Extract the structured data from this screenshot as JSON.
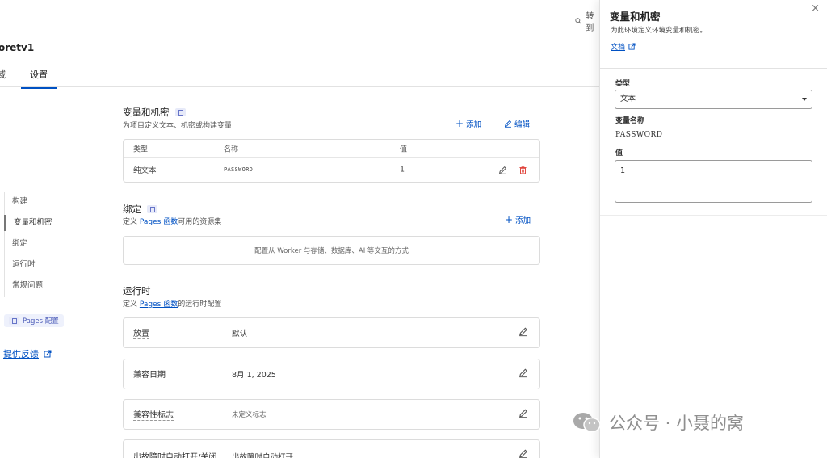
{
  "topbar": {
    "search_label": "转到"
  },
  "project": {
    "title": "oretv1"
  },
  "tabs": [
    "域",
    "设置"
  ],
  "left_nav": {
    "items": [
      "构建",
      "变量和机密",
      "绑定",
      "运行时",
      "常规问题"
    ],
    "pages_badge": "Pages 配置",
    "feedback": "提供反馈"
  },
  "variables": {
    "title": "变量和机密",
    "subtitle": "为项目定义文本、机密或构建变量",
    "add_label": "添加",
    "edit_label": "编辑",
    "columns": [
      "类型",
      "名称",
      "值"
    ],
    "rows": [
      {
        "type": "纯文本",
        "name": "PASSWORD",
        "value": "1"
      }
    ]
  },
  "bindings": {
    "title": "绑定",
    "subtitle_pre": "定义 ",
    "subtitle_link": "Pages 函数",
    "subtitle_post": "可用的资源集",
    "add_label": "添加",
    "empty_text": "配置从 Worker 与存储、数据库、AI 等交互的方式"
  },
  "runtime": {
    "title": "运行时",
    "subtitle_pre": "定义 ",
    "subtitle_link": "Pages 函数",
    "subtitle_post": "的运行时配置",
    "rows": [
      {
        "label": "放置",
        "value": "默认"
      },
      {
        "label": "兼容日期",
        "value": "8月 1, 2025"
      },
      {
        "label": "兼容性标志",
        "value": "未定义标志"
      },
      {
        "label": "出故障时自动打开/关闭",
        "value": "出故障时自动打开"
      }
    ]
  },
  "panel": {
    "title": "变量和机密",
    "subtitle": "为此环境定义环境变量和机密。",
    "doc_link": "文档",
    "close_icon": "×",
    "type_label": "类型",
    "type_value": "文本",
    "name_label": "变量名称",
    "name_value": "PASSWORD",
    "value_label": "值",
    "value_value": "1"
  },
  "watermark": {
    "text": "公众号 · 小聂的窝"
  },
  "colors": {
    "accent": "#0051c3",
    "delete": "#e0443c",
    "badge_bg": "#eef1fc"
  }
}
